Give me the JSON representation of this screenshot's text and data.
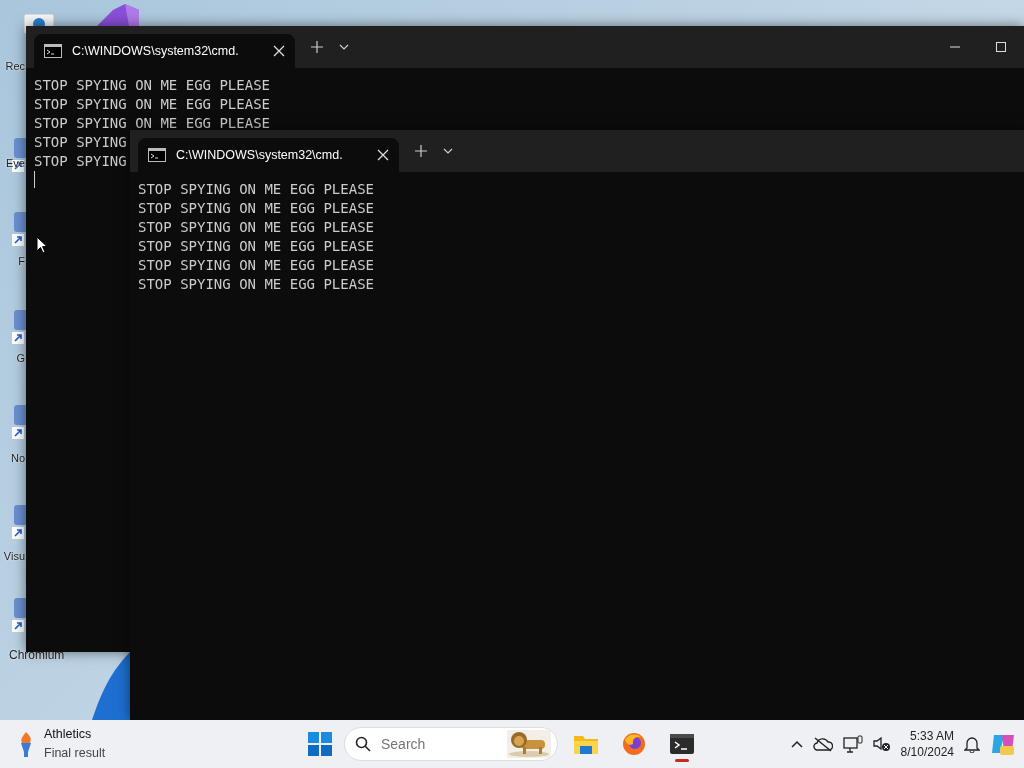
{
  "desktop": {
    "icons": [
      {
        "label": "Rec",
        "kind": "bin"
      },
      {
        "label": "Eve",
        "kind": "shortcut"
      },
      {
        "label": "F",
        "kind": "shortcut"
      },
      {
        "label": "G",
        "kind": "shortcut"
      },
      {
        "label": "No",
        "kind": "shortcut"
      },
      {
        "label": "Visu",
        "kind": "shortcut"
      },
      {
        "label": "Chromium",
        "kind": "shortcut"
      }
    ]
  },
  "windows": [
    {
      "tab_title": "C:\\WINDOWS\\system32\\cmd.",
      "controls": true,
      "cursor": true,
      "lines": [
        "STOP SPYING ON ME EGG PLEASE",
        "STOP SPYING ON ME EGG PLEASE",
        "STOP SPYING ON ME EGG PLEASE",
        "STOP SPYING",
        "STOP SPYING"
      ]
    },
    {
      "tab_title": "C:\\WINDOWS\\system32\\cmd.",
      "controls": false,
      "cursor": false,
      "lines": [
        "STOP SPYING ON ME EGG PLEASE",
        "STOP SPYING ON ME EGG PLEASE",
        "STOP SPYING ON ME EGG PLEASE",
        "STOP SPYING ON ME EGG PLEASE",
        "STOP SPYING ON ME EGG PLEASE",
        "STOP SPYING ON ME EGG PLEASE"
      ]
    }
  ],
  "taskbar": {
    "widget": {
      "title": "Athletics",
      "subtitle": "Final result"
    },
    "search": {
      "placeholder": "Search"
    },
    "apps": [
      {
        "kind": "files",
        "running": false
      },
      {
        "kind": "firefox",
        "running": false
      },
      {
        "kind": "terminal",
        "running": true
      }
    ],
    "clock": {
      "time": "5:33 AM",
      "date": "8/10/2024"
    }
  }
}
